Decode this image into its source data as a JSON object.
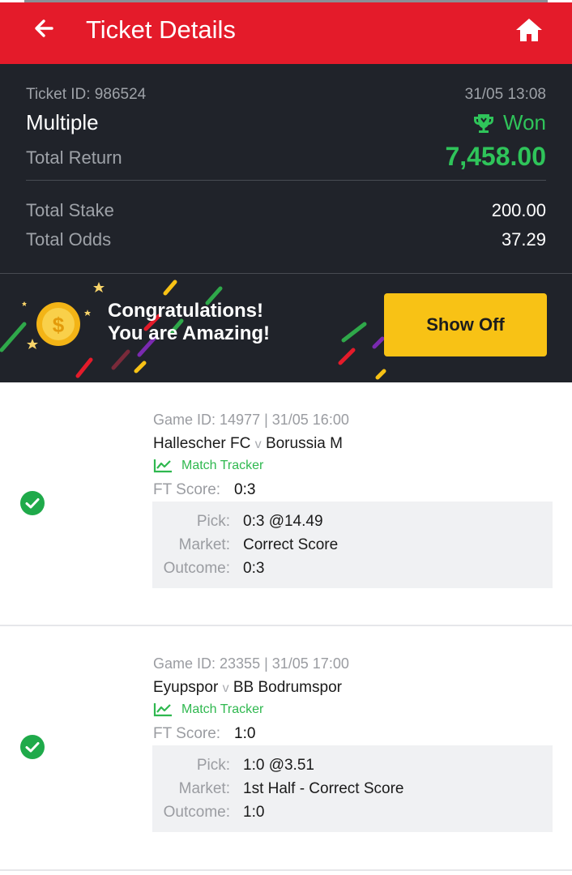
{
  "header": {
    "title": "Ticket Details",
    "back_icon": "arrow-left-icon",
    "home_icon": "home-icon"
  },
  "ticket": {
    "id_label": "Ticket ID: 986524",
    "datetime": "31/05 13:08",
    "bet_type": "Multiple",
    "status": "Won",
    "total_return_label": "Total Return",
    "total_return": "7,458.00",
    "total_stake_label": "Total Stake",
    "total_stake": "200.00",
    "total_odds_label": "Total Odds",
    "total_odds": "37.29"
  },
  "banner": {
    "line1": "Congratulations!",
    "line2": "You are Amazing!",
    "button": "Show Off"
  },
  "labels": {
    "tracker": "Match Tracker",
    "ft_score": "FT Score:",
    "pick": "Pick:",
    "market": "Market:",
    "outcome": "Outcome:",
    "vs": "v"
  },
  "selections": [
    {
      "game": "Game ID: 14977 | 31/05 16:00",
      "home": "Hallescher FC",
      "away": "Borussia M",
      "ft_score": "0:3",
      "pick": "0:3 @14.49",
      "market": "Correct Score",
      "outcome": "0:3"
    },
    {
      "game": "Game ID: 23355 | 31/05 17:00",
      "home": "Eyupspor",
      "away": "BB Bodrumspor",
      "ft_score": "1:0",
      "pick": "1:0 @3.51",
      "market": "1st Half - Correct Score",
      "outcome": "1:0"
    }
  ],
  "colors": {
    "header_red": "#e41b2a",
    "summary_bg": "#20232a",
    "won_green": "#2fc45a",
    "button_yellow": "#f8c215"
  }
}
